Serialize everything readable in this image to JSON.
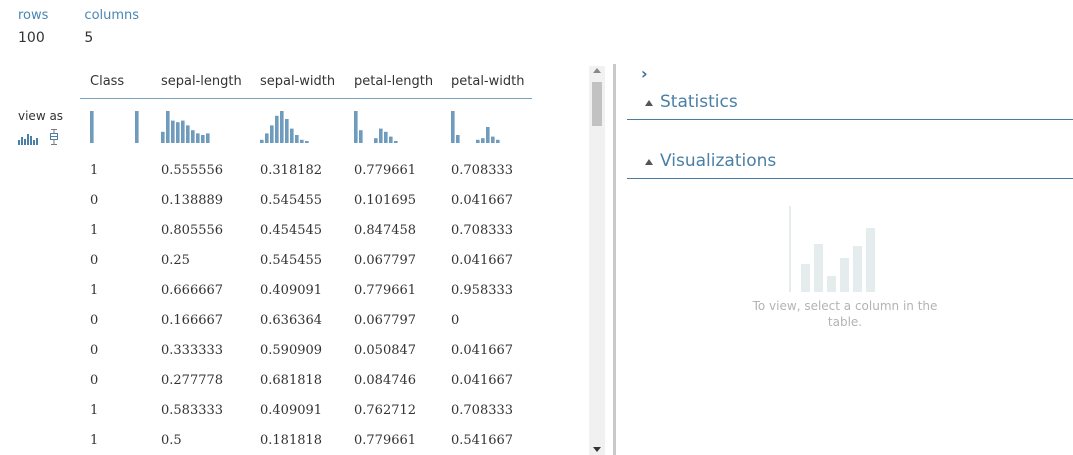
{
  "summary": {
    "rows_label": "rows",
    "rows_value": "100",
    "columns_label": "columns",
    "columns_value": "5"
  },
  "view_as": {
    "label": "view as",
    "icons": [
      "histogram-icon",
      "boxplot-icon"
    ]
  },
  "table": {
    "headers": [
      "Class",
      "sepal-length",
      "sepal-width",
      "petal-length",
      "petal-width"
    ],
    "rows": [
      [
        "1",
        "0.555556",
        "0.318182",
        "0.779661",
        "0.708333"
      ],
      [
        "0",
        "0.138889",
        "0.545455",
        "0.101695",
        "0.041667"
      ],
      [
        "1",
        "0.805556",
        "0.454545",
        "0.847458",
        "0.708333"
      ],
      [
        "0",
        "0.25",
        "0.545455",
        "0.067797",
        "0.041667"
      ],
      [
        "1",
        "0.666667",
        "0.409091",
        "0.779661",
        "0.958333"
      ],
      [
        "0",
        "0.166667",
        "0.636364",
        "0.067797",
        "0"
      ],
      [
        "0",
        "0.333333",
        "0.590909",
        "0.050847",
        "0.041667"
      ],
      [
        "0",
        "0.277778",
        "0.681818",
        "0.084746",
        "0.041667"
      ],
      [
        "1",
        "0.583333",
        "0.409091",
        "0.762712",
        "0.708333"
      ],
      [
        "1",
        "0.5",
        "0.181818",
        "0.779661",
        "0.541667"
      ]
    ]
  },
  "mini_histograms": [
    [
      1,
      0,
      0,
      0,
      0,
      0,
      0,
      0,
      0,
      1
    ],
    [
      0.35,
      1,
      0.7,
      0.65,
      0.7,
      0.55,
      0.4,
      0.3,
      0.25,
      0.3
    ],
    [
      0.1,
      0.3,
      0.55,
      0.85,
      1,
      0.75,
      0.45,
      0.25,
      0.1,
      0.05
    ],
    [
      1,
      0.4,
      0,
      0,
      0.15,
      0.45,
      0.35,
      0.2,
      0.05,
      0
    ],
    [
      1,
      0.25,
      0,
      0,
      0,
      0.1,
      0.15,
      0.5,
      0.2,
      0.1
    ]
  ],
  "right_panel": {
    "statistics_label": "Statistics",
    "visualizations_label": "Visualizations",
    "placeholder_text": "To view, select a column in the table."
  },
  "colors": {
    "accent": "#4a7fa6",
    "histogram_bar": "#6f9bbd",
    "placeholder_bar": "#e4ecee"
  }
}
